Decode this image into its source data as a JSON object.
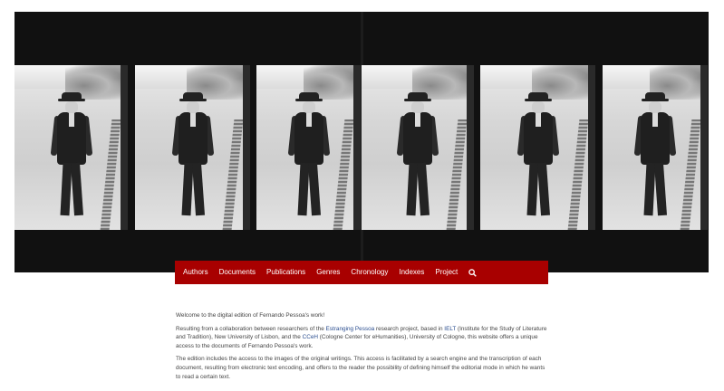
{
  "hero": {
    "image_alt": "Film strip of Fernando Pessoa walking",
    "frame_count": 6
  },
  "nav": {
    "items": [
      "Authors",
      "Documents",
      "Publications",
      "Genres",
      "Chronology",
      "Indexes",
      "Project"
    ],
    "search_icon": "search-icon"
  },
  "content": {
    "welcome": "Welcome to the digital edition of Fernando Pessoa's work!",
    "p1_part1": "Resulting from a collaboration between researchers of the ",
    "p1_link1": "Estranging Pessoa",
    "p1_part2": " research project, based in ",
    "p1_link2": "IELT",
    "p1_part3": " (Institute for the Study of Literature and Tradition), New University of Lisbon, and the ",
    "p1_link3": "CCeH",
    "p1_part4": " (Cologne Center for eHumanities), University of Cologne, this website offers a unique access to the documents of Fernando Pessoa's work.",
    "p2": "The edition includes the access to the images of the original writings. This access is facilitated by a search engine and the transcription of each document, resulting from electronic text encoding, and offers to the reader the possibility of defining himself the editorial mode in which he wants to read a certain text."
  },
  "colors": {
    "nav_bg": "#a80000",
    "link": "#2a4d8f",
    "text": "#444444",
    "hero_bg": "#111111"
  }
}
